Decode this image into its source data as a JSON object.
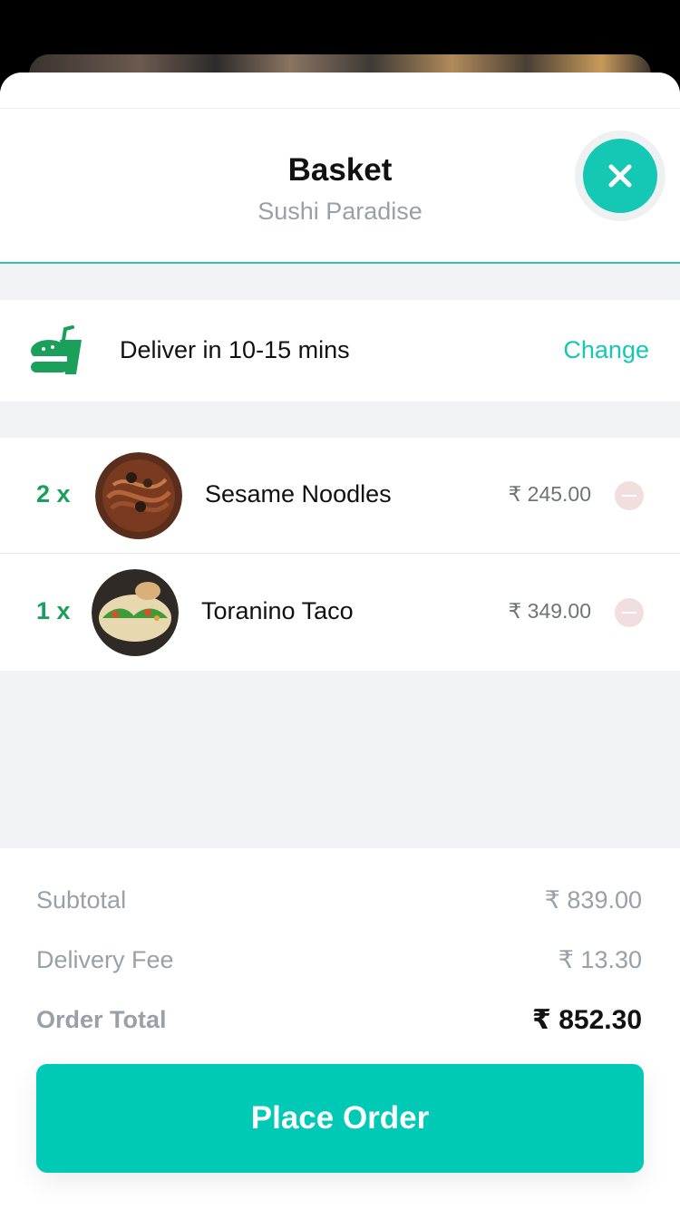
{
  "header": {
    "title": "Basket",
    "subtitle": "Sushi Paradise",
    "close_icon": "close-icon"
  },
  "delivery": {
    "icon": "takeaway-food-icon",
    "text": "Deliver in 10-15 mins",
    "change_label": "Change"
  },
  "items": [
    {
      "qty": "2 x",
      "name": "Sesame Noodles",
      "price": "₹ 245.00",
      "image": "noodles-photo"
    },
    {
      "qty": "1 x",
      "name": "Toranino Taco",
      "price": "₹ 349.00",
      "image": "taco-photo"
    }
  ],
  "summary": {
    "subtotal_label": "Subtotal",
    "subtotal_value": "₹ 839.00",
    "delivery_fee_label": "Delivery Fee",
    "delivery_fee_value": "₹ 13.30",
    "total_label": "Order Total",
    "total_value": "₹ 852.30"
  },
  "actions": {
    "place_order_label": "Place Order"
  },
  "colors": {
    "accent": "#00c9b5",
    "qty_green": "#1aa05a",
    "divider": "#2ec6a6"
  }
}
